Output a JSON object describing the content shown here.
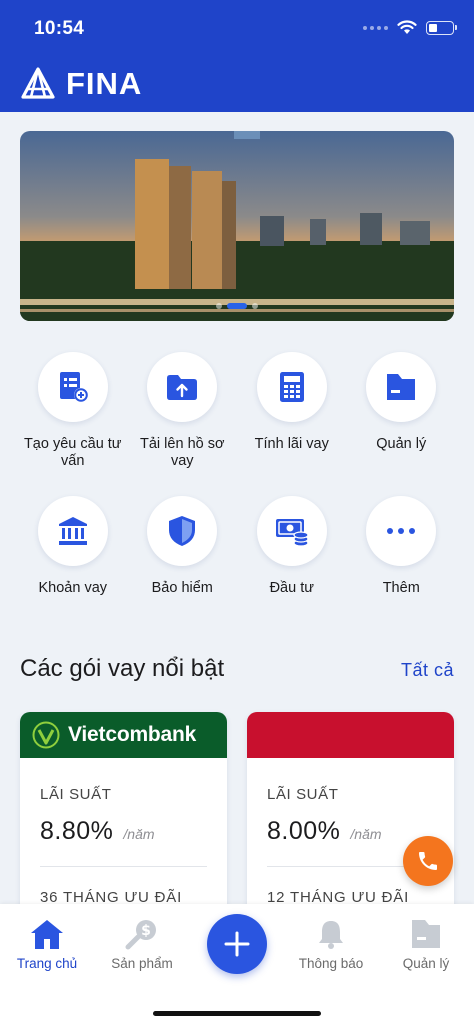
{
  "status_bar": {
    "time": "10:54"
  },
  "header": {
    "brand": "FINA"
  },
  "banner": {
    "slide_count": 3,
    "active_slide": 2
  },
  "services": [
    {
      "label": "Tạo yêu cầu tư vấn",
      "icon": "request-consult-icon"
    },
    {
      "label": "Tải lên hồ sơ vay",
      "icon": "upload-icon"
    },
    {
      "label": "Tính lãi vay",
      "icon": "calculator-icon"
    },
    {
      "label": "Quản lý",
      "icon": "folder-icon"
    },
    {
      "label": "Khoản vay",
      "icon": "bank-icon"
    },
    {
      "label": "Bảo hiểm",
      "icon": "shield-icon"
    },
    {
      "label": "Đầu tư",
      "icon": "money-icon"
    },
    {
      "label": "Thêm",
      "icon": "more-icon"
    }
  ],
  "featured": {
    "title": "Các gói vay nổi bật",
    "see_all": "Tất cả",
    "cards": [
      {
        "bank": "Vietcombank",
        "head_color": "#0a5c2a",
        "rate_label": "LÃI SUẤT",
        "rate": "8.80%",
        "unit": "/năm",
        "promo": "36 THÁNG ƯU ĐÃI"
      },
      {
        "bank": "",
        "head_color": "#c8102e",
        "rate_label": "LÃI SUẤT",
        "rate": "8.00%",
        "unit": "/năm",
        "promo": "12 THÁNG ƯU ĐÃI"
      }
    ]
  },
  "tabs": [
    {
      "label": "Trang chủ",
      "icon": "home-icon",
      "active": true
    },
    {
      "label": "Sản phẩm",
      "icon": "product-search-icon",
      "active": false
    },
    {
      "label": "Thông báo",
      "icon": "bell-icon",
      "active": false
    },
    {
      "label": "Quản lý",
      "icon": "folder-icon",
      "active": false
    }
  ],
  "colors": {
    "primary": "#1f44c9",
    "accent": "#2a55e0",
    "call": "#f4751e"
  }
}
